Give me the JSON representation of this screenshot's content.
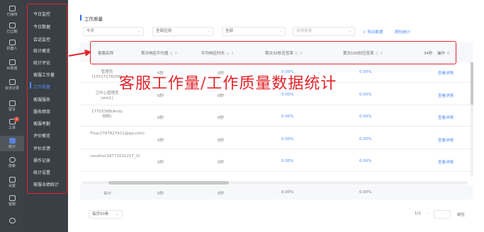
{
  "rail": [
    {
      "label": "已接待",
      "icon": "chat-icon"
    },
    {
      "label": "已过期",
      "icon": "clock-icon"
    },
    {
      "label": "机器人",
      "icon": "robot-icon"
    },
    {
      "label": "AI助理",
      "icon": "ai-icon"
    },
    {
      "label": "会话记录",
      "icon": "record-icon"
    },
    {
      "label": "留言",
      "icon": "message-icon"
    },
    {
      "label": "工单",
      "icon": "ticket-icon",
      "badge": "6"
    },
    {
      "label": "统计",
      "icon": "stats-icon",
      "active": true
    },
    {
      "label": "搜索",
      "icon": "search-icon"
    },
    {
      "label": "设置",
      "icon": "settings-icon"
    },
    {
      "label": "客服",
      "icon": "agent-icon"
    },
    {
      "label": "",
      "icon": "gear-icon"
    }
  ],
  "menu": [
    {
      "label": "今日监控"
    },
    {
      "label": "今日数据"
    },
    {
      "label": "会话监控"
    },
    {
      "label": "统计概览"
    },
    {
      "label": "统计评论"
    },
    {
      "label": "客服工作量"
    },
    {
      "label": "工作质量",
      "active": true
    },
    {
      "label": "客服服务"
    },
    {
      "label": "服务绩效"
    },
    {
      "label": "客服考勤"
    },
    {
      "label": "评价概览"
    },
    {
      "label": "评价反馈"
    },
    {
      "label": "操作记录"
    },
    {
      "label": "统计设置"
    },
    {
      "label": "客服业绩统计"
    }
  ],
  "page": {
    "title": "工作质量"
  },
  "filters": {
    "date": "今天",
    "app": "全部应用",
    "group": "全部",
    "agent_placeholder": "选择客服",
    "export_label": "导出数据",
    "overview_label": "质检统计"
  },
  "columns": [
    "客服名称",
    "首次响应平均值",
    "平均响应时长",
    "首次30秒应答率",
    "首次150秒应答率",
    "34秒",
    "操作"
  ],
  "rows": [
    {
      "name": "管理员(15517178208)",
      "c1": "0秒",
      "c2": "0秒",
      "c3": "0.00%",
      "c4": "0.00%",
      "action": "查看详情"
    },
    {
      "name": "卫中心管理员(ww1)",
      "c1": "0秒",
      "c2": "0秒",
      "c3": "0.00%",
      "c4": "0.00%",
      "action": "查看详情"
    },
    {
      "name": "17703388(Andy桃桃)",
      "c1": "0秒",
      "c2": "0秒",
      "c3": "0.00%",
      "c4": "0.00%",
      "action": "查看详情"
    },
    {
      "name": "Tina(2787827421@qq.com)",
      "c1": "0秒",
      "c2": "0秒",
      "c3": "0.00%",
      "c4": "0.00%",
      "action": "查看详情"
    },
    {
      "name": "candice(18771031217_2)",
      "c1": "0秒",
      "c2": "0秒",
      "c3": "0.00%",
      "c4": "0.00%",
      "action": "查看详情"
    }
  ],
  "total": {
    "label": "合计",
    "c1": "0秒",
    "c2": "0秒",
    "c3": "0.00%",
    "c4": "0.00%"
  },
  "overlay_title": "客服工作量/工作质量数据统计",
  "pagination": {
    "page_size": "每页50条",
    "page_info": "1/1",
    "goto_label": "前往"
  },
  "colors": {
    "accent": "#4f8cf7",
    "highlight": "#e3252b",
    "sidebar": "#3c4147"
  }
}
